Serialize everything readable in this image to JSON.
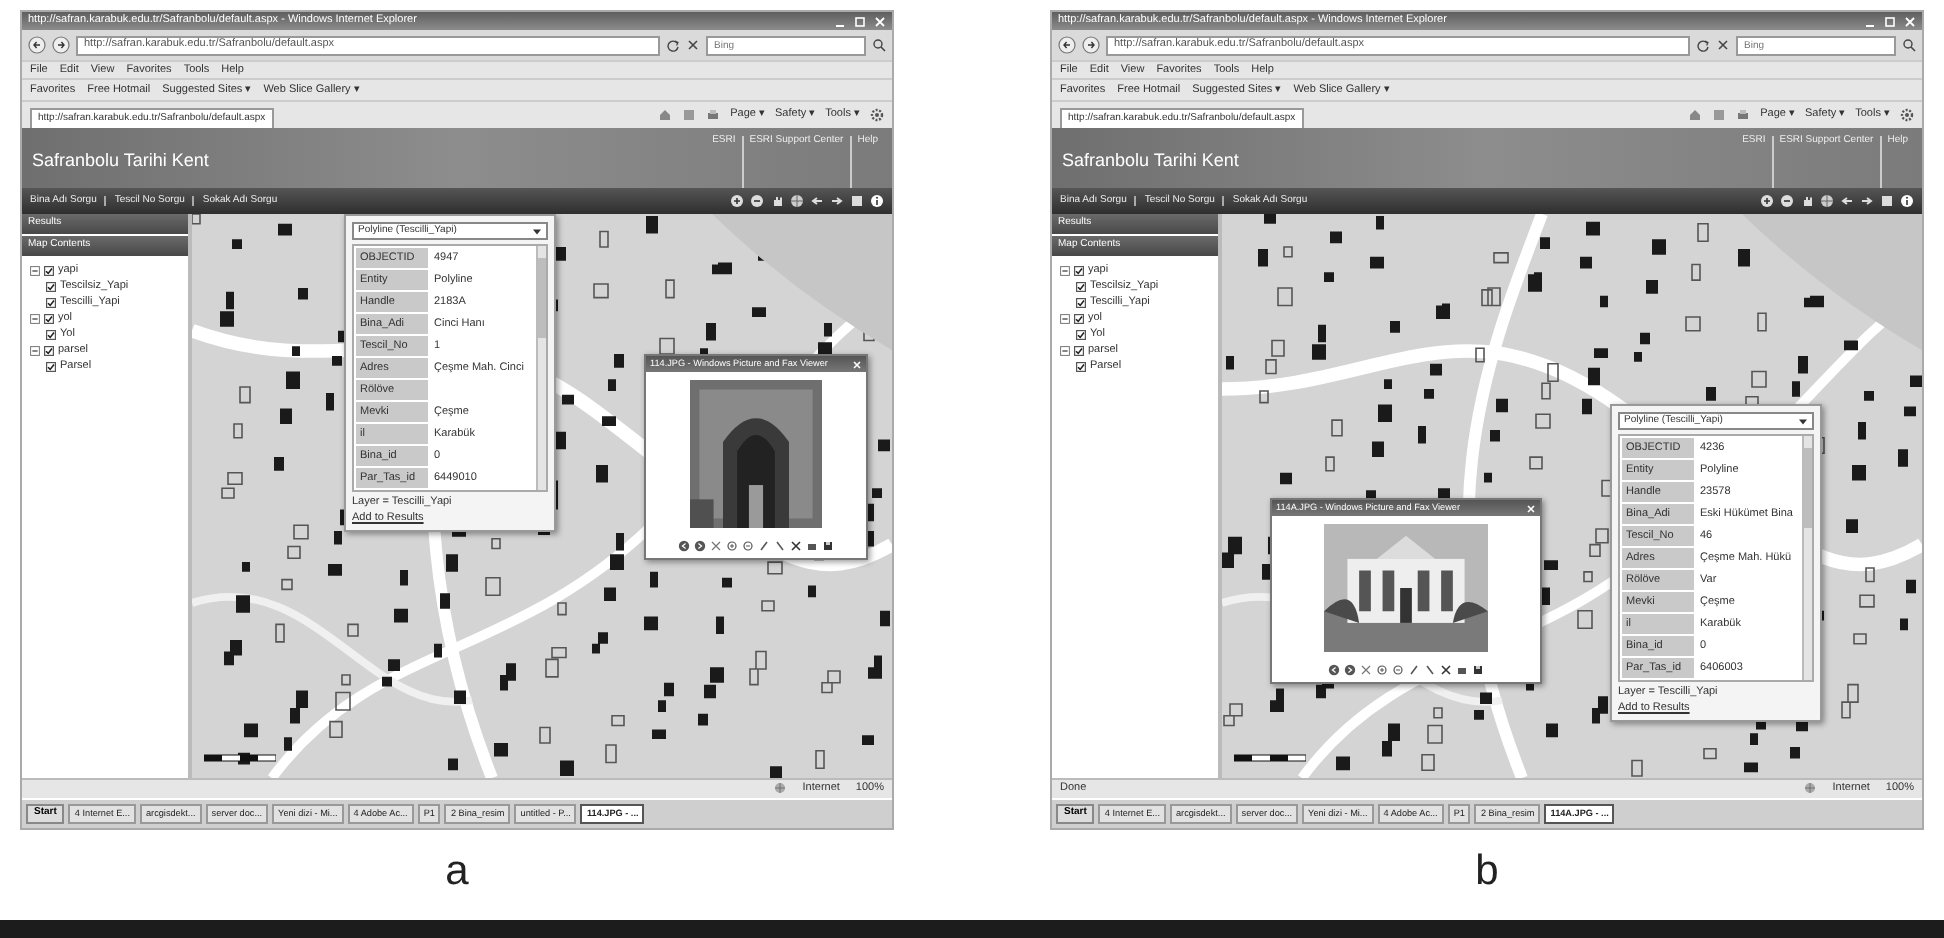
{
  "panels": [
    {
      "label": "a",
      "window_title": "http://safran.karabuk.edu.tr/Safranbolu/default.aspx - Windows Internet Explorer",
      "address": "http://safran.karabuk.edu.tr/Safranbolu/default.aspx",
      "search_placeholder": "Bing",
      "menu": [
        "File",
        "Edit",
        "View",
        "Favorites",
        "Tools",
        "Help"
      ],
      "favorites": [
        "Favorites",
        "Free Hotmail",
        "Suggested Sites ▾",
        "Web Slice Gallery ▾"
      ],
      "tab": "http://safran.karabuk.edu.tr/Safranbolu/default.aspx",
      "commands": [
        "Page ▾",
        "Safety ▾",
        "Tools ▾"
      ],
      "site_title": "Safranbolu Tarihi Kent",
      "site_links": [
        "ESRI",
        "ESRI Support Center",
        "Help"
      ],
      "queries": [
        "Bina Adı Sorgu",
        "Tescil No Sorgu",
        "Sokak Adı Sorgu"
      ],
      "sidebar": {
        "sections": [
          "Results",
          "Map Contents"
        ],
        "tree": [
          {
            "label": "yapi",
            "expanded": true,
            "checked": true,
            "children": [
              {
                "label": "Tescilsiz_Yapi",
                "checked": true
              },
              {
                "label": "Tescilli_Yapi",
                "checked": true
              }
            ]
          },
          {
            "label": "yol",
            "expanded": true,
            "checked": true,
            "children": [
              {
                "label": "Yol",
                "checked": true
              }
            ]
          },
          {
            "label": "parsel",
            "expanded": true,
            "checked": true,
            "children": [
              {
                "label": "Parsel",
                "checked": true
              }
            ]
          }
        ]
      },
      "popup": {
        "title": "Polyline (Tescilli_Yapi)",
        "fields": [
          {
            "name": "OBJECTID",
            "value": "4947"
          },
          {
            "name": "Entity",
            "value": "Polyline"
          },
          {
            "name": "Handle",
            "value": "2183A"
          },
          {
            "name": "Bina_Adi",
            "value": "Cinci Hanı"
          },
          {
            "name": "Tescil_No",
            "value": "1"
          },
          {
            "name": "Adres",
            "value": "Çeşme Mah. Cinci"
          },
          {
            "name": "Rölöve"
          },
          {
            "name": "Mevki",
            "value": "Çeşme"
          },
          {
            "name": "il",
            "value": "Karabük"
          },
          {
            "name": "Bina_id",
            "value": "0"
          },
          {
            "name": "Par_Tas_id",
            "value": "6449010"
          }
        ],
        "layer": "Layer = Tescilli_Yapi",
        "link": "Add to Results"
      },
      "viewer": {
        "title": "114.JPG - Windows Picture and Fax Viewer"
      },
      "status": {
        "zone": "Internet",
        "zoom": "100%"
      },
      "taskbar": {
        "start": "Start",
        "items": [
          {
            "label": "4 Internet E...",
            "selected": false
          },
          {
            "label": "arcgisdekt...",
            "selected": false
          },
          {
            "label": "server doc...",
            "selected": false
          },
          {
            "label": "Yeni dizi - Mi...",
            "selected": false
          },
          {
            "label": "4 Adobe Ac...",
            "selected": false
          },
          {
            "label": "P1",
            "selected": false
          },
          {
            "label": "2 Bina_resim",
            "selected": false
          },
          {
            "label": "untitled - P...",
            "selected": false
          },
          {
            "label": "114.JPG - ...",
            "selected": true
          }
        ]
      }
    },
    {
      "label": "b",
      "window_title": "http://safran.karabuk.edu.tr/Safranbolu/default.aspx - Windows Internet Explorer",
      "address": "http://safran.karabuk.edu.tr/Safranbolu/default.aspx",
      "search_placeholder": "Bing",
      "menu": [
        "File",
        "Edit",
        "View",
        "Favorites",
        "Tools",
        "Help"
      ],
      "favorites": [
        "Favorites",
        "Free Hotmail",
        "Suggested Sites ▾",
        "Web Slice Gallery ▾"
      ],
      "tab": "http://safran.karabuk.edu.tr/Safranbolu/default.aspx",
      "commands": [
        "Page ▾",
        "Safety ▾",
        "Tools ▾"
      ],
      "site_title": "Safranbolu Tarihi Kent",
      "site_links": [
        "ESRI",
        "ESRI Support Center",
        "Help"
      ],
      "queries": [
        "Bina Adı Sorgu",
        "Tescil No Sorgu",
        "Sokak Adı Sorgu"
      ],
      "sidebar": {
        "sections": [
          "Results",
          "Map Contents"
        ],
        "tree": [
          {
            "label": "yapi",
            "expanded": true,
            "checked": true,
            "children": [
              {
                "label": "Tescilsiz_Yapi",
                "checked": true
              },
              {
                "label": "Tescilli_Yapi",
                "checked": true
              }
            ]
          },
          {
            "label": "yol",
            "expanded": true,
            "checked": true,
            "children": [
              {
                "label": "Yol",
                "checked": true
              }
            ]
          },
          {
            "label": "parsel",
            "expanded": true,
            "checked": true,
            "children": [
              {
                "label": "Parsel",
                "checked": true
              }
            ]
          }
        ]
      },
      "popup": {
        "title": "Polyline (Tescilli_Yapi)",
        "fields": [
          {
            "name": "OBJECTID",
            "value": "4236"
          },
          {
            "name": "Entity",
            "value": "Polyline"
          },
          {
            "name": "Handle",
            "value": "23578"
          },
          {
            "name": "Bina_Adi",
            "value": "Eski Hükümet Bina"
          },
          {
            "name": "Tescil_No",
            "value": "46"
          },
          {
            "name": "Adres",
            "value": "Çeşme Mah. Hükü"
          },
          {
            "name": "Rölöve",
            "value": "Var"
          },
          {
            "name": "Mevki",
            "value": "Çeşme"
          },
          {
            "name": "il",
            "value": "Karabük"
          },
          {
            "name": "Bina_id",
            "value": "0"
          },
          {
            "name": "Par_Tas_id",
            "value": "6406003"
          }
        ],
        "layer": "Layer = Tescilli_Yapi",
        "link": "Add to Results"
      },
      "viewer": {
        "title": "114A.JPG - Windows Picture and Fax Viewer"
      },
      "status": {
        "text": "Done",
        "zone": "Internet",
        "zoom": "100%"
      },
      "taskbar": {
        "start": "Start",
        "items": [
          {
            "label": "4 Internet E...",
            "selected": false
          },
          {
            "label": "arcgisdekt...",
            "selected": false
          },
          {
            "label": "server doc...",
            "selected": false
          },
          {
            "label": "Yeni dizi - Mi...",
            "selected": false
          },
          {
            "label": "4 Adobe Ac...",
            "selected": false
          },
          {
            "label": "P1",
            "selected": false
          },
          {
            "label": "2 Bina_resim",
            "selected": false
          },
          {
            "label": "114A.JPG - ...",
            "selected": true
          }
        ]
      }
    }
  ]
}
